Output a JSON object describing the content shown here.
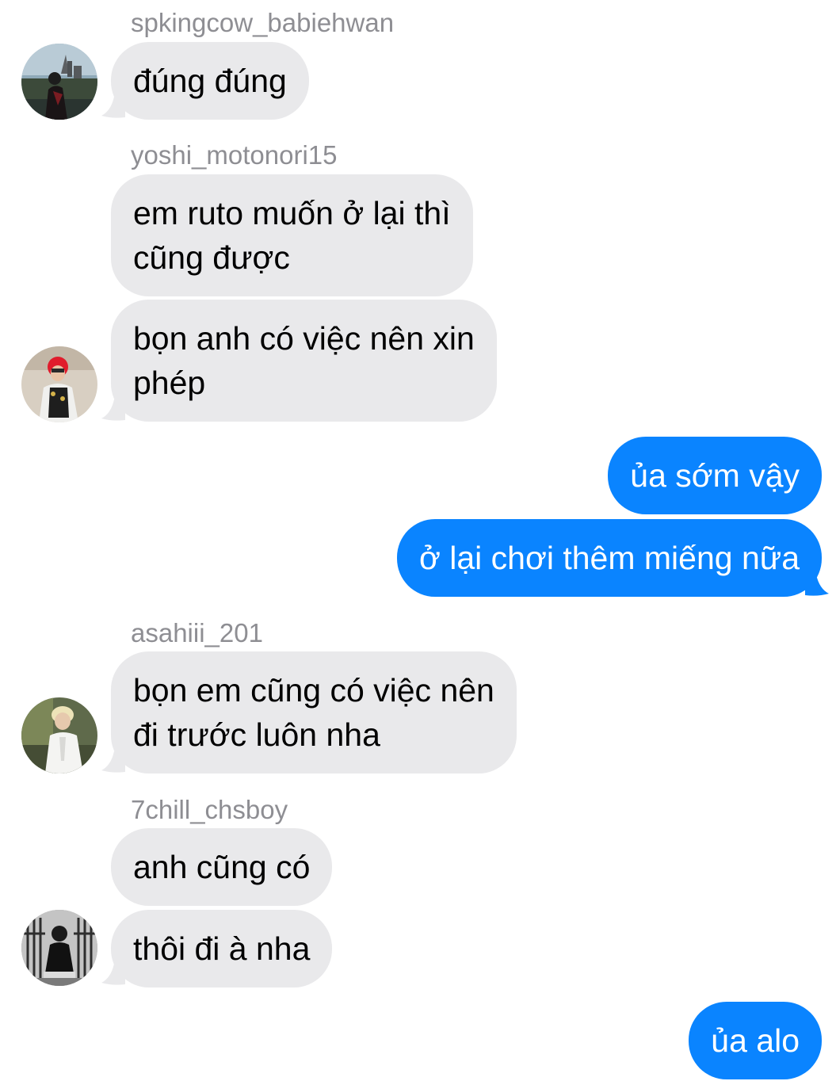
{
  "colors": {
    "incoming_bubble": "#e9e9eb",
    "outgoing_bubble": "#0a84ff",
    "sender_name": "#8e8e93"
  },
  "messages": [
    {
      "sender": "spkingcow_babiehwan",
      "text": "đúng đúng",
      "direction": "incoming"
    },
    {
      "sender": "yoshi_motonori15",
      "text": "em ruto muốn ở lại thì\ncũng được",
      "direction": "incoming"
    },
    {
      "sender": "yoshi_motonori15",
      "text": "bọn anh có việc nên xin\nphép",
      "direction": "incoming"
    },
    {
      "sender": "me",
      "text": "ủa sớm vậy",
      "direction": "outgoing"
    },
    {
      "sender": "me",
      "text": "ở lại chơi thêm miếng nữa",
      "direction": "outgoing"
    },
    {
      "sender": "asahiii_201",
      "text": "bọn em cũng có việc nên\nđi trước luôn nha",
      "direction": "incoming"
    },
    {
      "sender": "7chill_chsboy",
      "text": "anh cũng có",
      "direction": "incoming"
    },
    {
      "sender": "7chill_chsboy",
      "text": "thôi đi à nha",
      "direction": "incoming"
    },
    {
      "sender": "me",
      "text": "ủa alo",
      "direction": "outgoing"
    }
  ],
  "senders": {
    "s1": "spkingcow_babiehwan",
    "s2": "yoshi_motonori15",
    "s3": "asahiii_201",
    "s4": "7chill_chsboy"
  },
  "avatars": [
    {
      "user": "spkingcow_babiehwan",
      "icon": "avatar-photo-castle"
    },
    {
      "user": "yoshi_motonori15",
      "icon": "avatar-photo-red-hair"
    },
    {
      "user": "asahiii_201",
      "icon": "avatar-photo-blond"
    },
    {
      "user": "7chill_chsboy",
      "icon": "avatar-photo-bw-stairs"
    }
  ]
}
